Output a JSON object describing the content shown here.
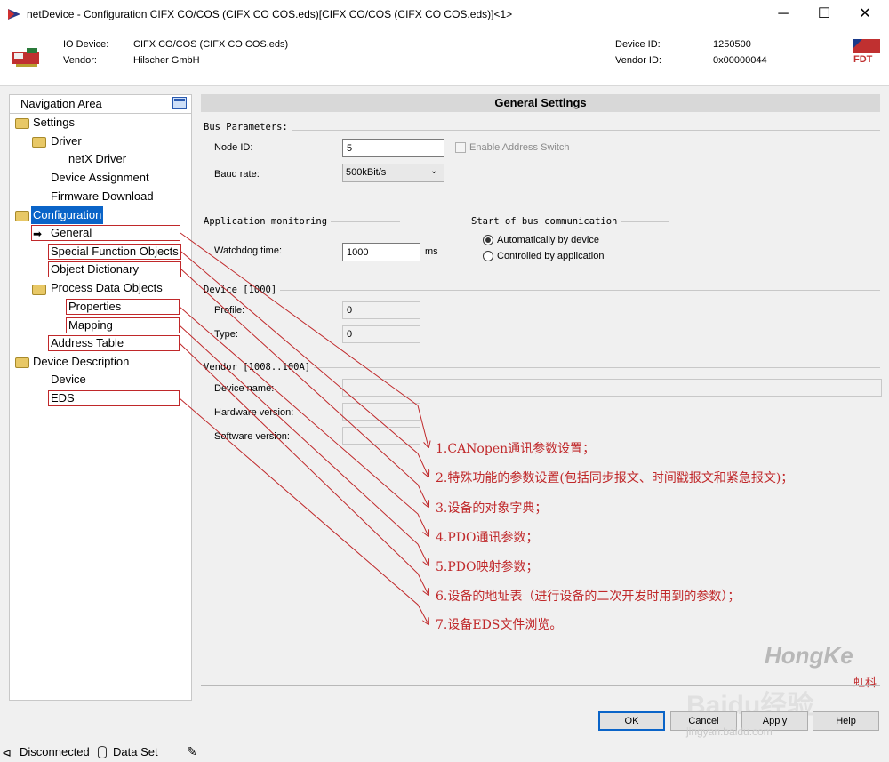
{
  "window": {
    "title": "netDevice - Configuration CIFX CO/COS (CIFX CO COS.eds)[CIFX CO/COS (CIFX CO COS.eds)]<1>"
  },
  "header": {
    "io_device_label": "IO Device:",
    "io_device_value": "CIFX CO/COS (CIFX CO COS.eds)",
    "vendor_label": "Vendor:",
    "vendor_value": "Hilscher GmbH",
    "device_id_label": "Device ID:",
    "device_id_value": "1250500",
    "vendor_id_label": "Vendor ID:",
    "vendor_id_value": "0x00000044",
    "fdt_logo": "FDT"
  },
  "nav": {
    "title": "Navigation Area",
    "items": [
      {
        "label": "Settings"
      },
      {
        "label": "Driver"
      },
      {
        "label": "netX Driver"
      },
      {
        "label": "Device Assignment"
      },
      {
        "label": "Firmware Download"
      },
      {
        "label": "Configuration"
      },
      {
        "label": "General"
      },
      {
        "label": "Special Function Objects"
      },
      {
        "label": "Object Dictionary"
      },
      {
        "label": "Process Data Objects"
      },
      {
        "label": "Properties"
      },
      {
        "label": "Mapping"
      },
      {
        "label": "Address Table"
      },
      {
        "label": "Device Description"
      },
      {
        "label": "Device"
      },
      {
        "label": "EDS"
      }
    ]
  },
  "main": {
    "title": "General Settings",
    "bus_parameters": "Bus Parameters:",
    "node_id_label": "Node ID:",
    "node_id_value": "5",
    "enable_address_switch": "Enable Address Switch",
    "baud_rate_label": "Baud rate:",
    "baud_rate_value": "500kBit/s",
    "app_monitoring": "Application monitoring",
    "watchdog_label": "Watchdog time:",
    "watchdog_value": "1000",
    "watchdog_unit": "ms",
    "start_comm": "Start of bus communication",
    "auto_device": "Automatically by device",
    "controlled_app": "Controlled by application",
    "device_section": "Device [1000]",
    "profile_label": "Profile:",
    "profile_value": "0",
    "type_label": "Type:",
    "type_value": "0",
    "vendor_section": "Vendor [1008..100A]",
    "device_name_label": "Device name:",
    "hw_version_label": "Hardware version:",
    "sw_version_label": "Software version:"
  },
  "annotations": [
    "1.CANopen通讯参数设置；",
    "2.特殊功能的参数设置(包括同步报文、时间戳报文和紧急报文)；",
    "3.设备的对象字典；",
    "4.PDO通讯参数；",
    "5.PDO映射参数；",
    "6.设备的地址表（进行设备的二次开发时用到的参数）；",
    "7.设备EDS文件浏览。"
  ],
  "buttons": {
    "ok": "OK",
    "cancel": "Cancel",
    "apply": "Apply",
    "help": "Help"
  },
  "status": {
    "connection": "Disconnected",
    "dataset": "Data Set"
  },
  "watermark": {
    "hongke": "HongKe",
    "hongke_cn": "虹科",
    "baidu": "Baidu经验",
    "url": "jingyan.baidu.com"
  },
  "colors": {
    "annotation": "#c0282a",
    "selection": "#0a64c8"
  }
}
